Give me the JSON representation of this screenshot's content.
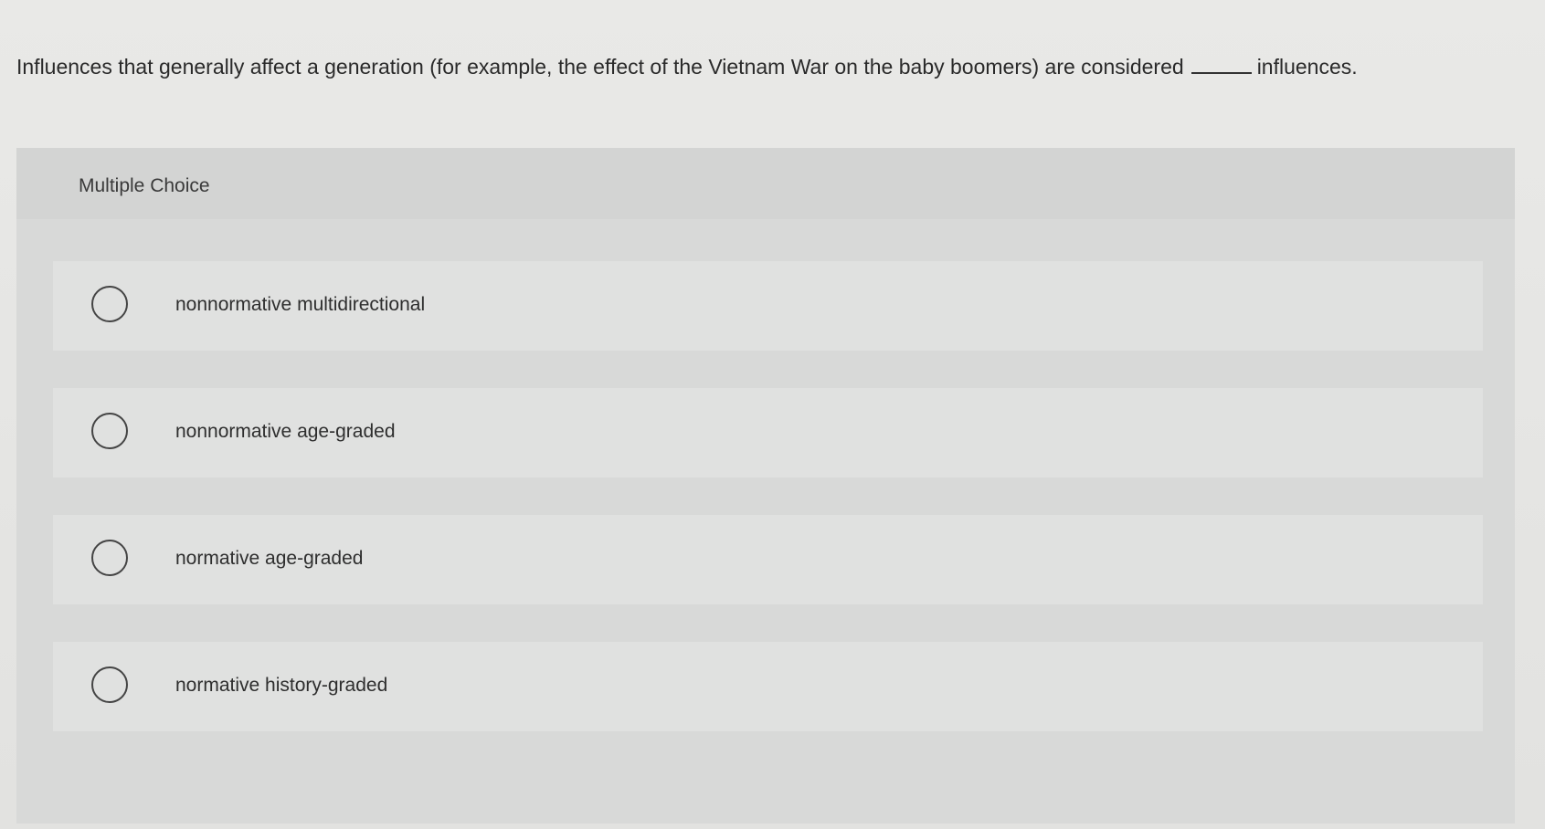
{
  "question": {
    "text_before": "Influences that generally affect a generation (for example, the effect of the Vietnam War on the baby boomers) are considered",
    "text_after": "influences."
  },
  "panel": {
    "title": "Multiple Choice"
  },
  "options": [
    {
      "label": "nonnormative multidirectional",
      "selected": false
    },
    {
      "label": "nonnormative age-graded",
      "selected": false
    },
    {
      "label": "normative age-graded",
      "selected": false
    },
    {
      "label": "normative history-graded",
      "selected": false
    }
  ]
}
